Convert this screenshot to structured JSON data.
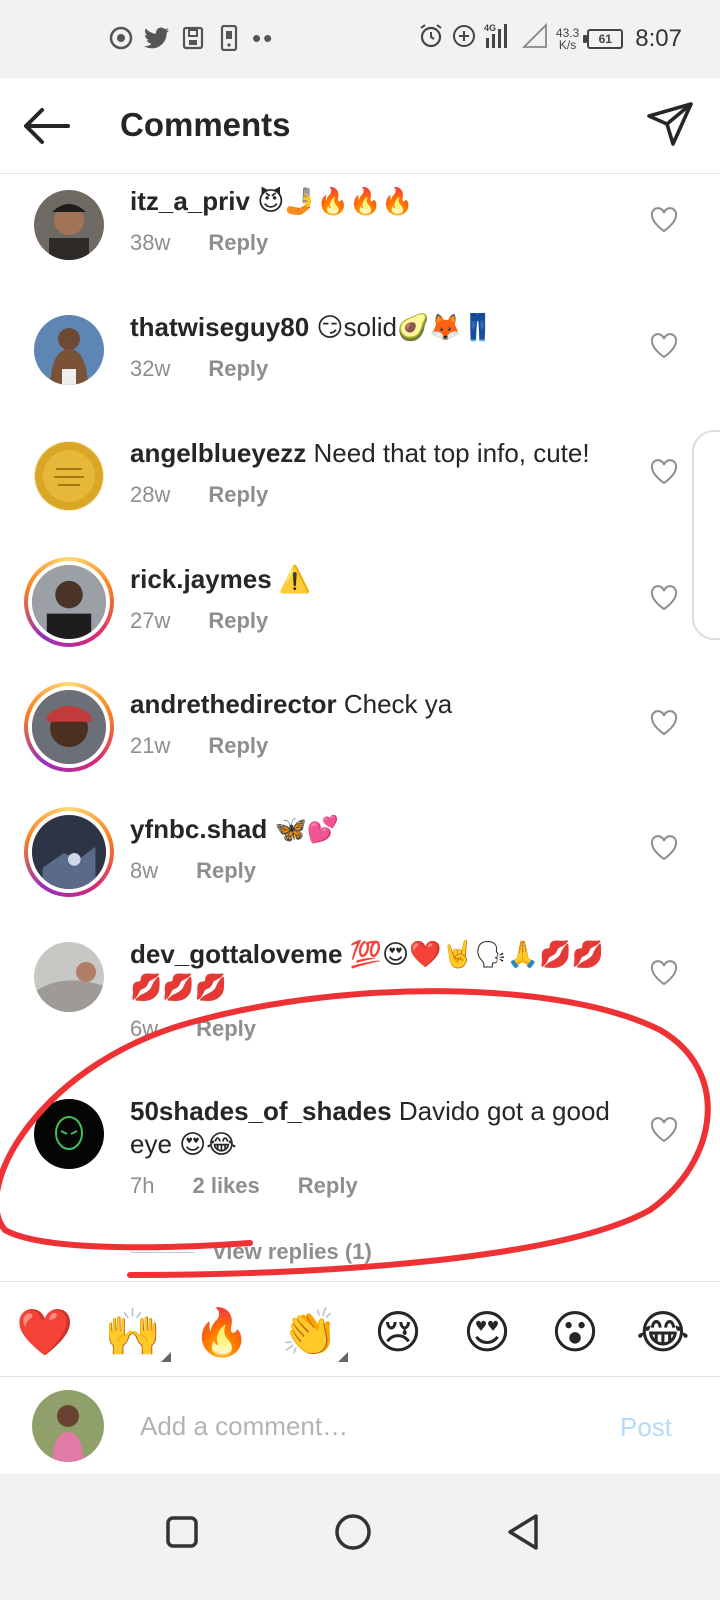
{
  "status_bar": {
    "time": "8:07",
    "net_speed_value": "43.3",
    "net_speed_unit": "K/s",
    "battery": "61",
    "signal_label": "4G",
    "left_icons": [
      "chrome-icon",
      "twitter-icon",
      "save-icon",
      "phone-icon"
    ],
    "right_icons": [
      "alarm-icon",
      "plus-circle-icon",
      "signal-icon",
      "wifi-off-icon",
      "battery-icon"
    ]
  },
  "header": {
    "title": "Comments"
  },
  "comments": [
    {
      "username": "itz_a_priv",
      "text": "😈🤳🔥🔥🔥",
      "age": "38w",
      "likes": "",
      "reply_label": "Reply"
    },
    {
      "username": "thatwiseguy80",
      "text": "😏solid🥑🦊👖",
      "age": "32w",
      "likes": "",
      "reply_label": "Reply"
    },
    {
      "username": "angelblueyezz",
      "text": "Need that top info, cute!",
      "age": "28w",
      "likes": "",
      "reply_label": "Reply"
    },
    {
      "username": "rick.jaymes",
      "text": "⚠️",
      "age": "27w",
      "likes": "",
      "reply_label": "Reply"
    },
    {
      "username": "andrethedirector",
      "text": "Check ya",
      "age": "21w",
      "likes": "",
      "reply_label": "Reply"
    },
    {
      "username": "yfnbc.shad",
      "text": "🦋💕",
      "age": "8w",
      "likes": "",
      "reply_label": "Reply"
    },
    {
      "username": "dev_gottaloveme",
      "text": "💯😍❤️🤘🗣🙏💋💋💋💋💋",
      "age": "6w",
      "likes": "",
      "reply_label": "Reply"
    },
    {
      "username": "50shades_of_shades",
      "text": "Davido got a good eye 😍😂",
      "age": "7h",
      "likes": "2 likes",
      "reply_label": "Reply"
    }
  ],
  "view_replies": "View replies (1)",
  "emoji_bar": [
    "❤️",
    "🙌",
    "🔥",
    "👏",
    "😢",
    "😍",
    "😮",
    "😂"
  ],
  "add_comment": {
    "placeholder": "Add a comment…",
    "post_label": "Post"
  },
  "colors": {
    "annotation_red": "#ee3134",
    "post_disabled": "#b3dbff",
    "meta_gray": "#8e8e8e"
  }
}
